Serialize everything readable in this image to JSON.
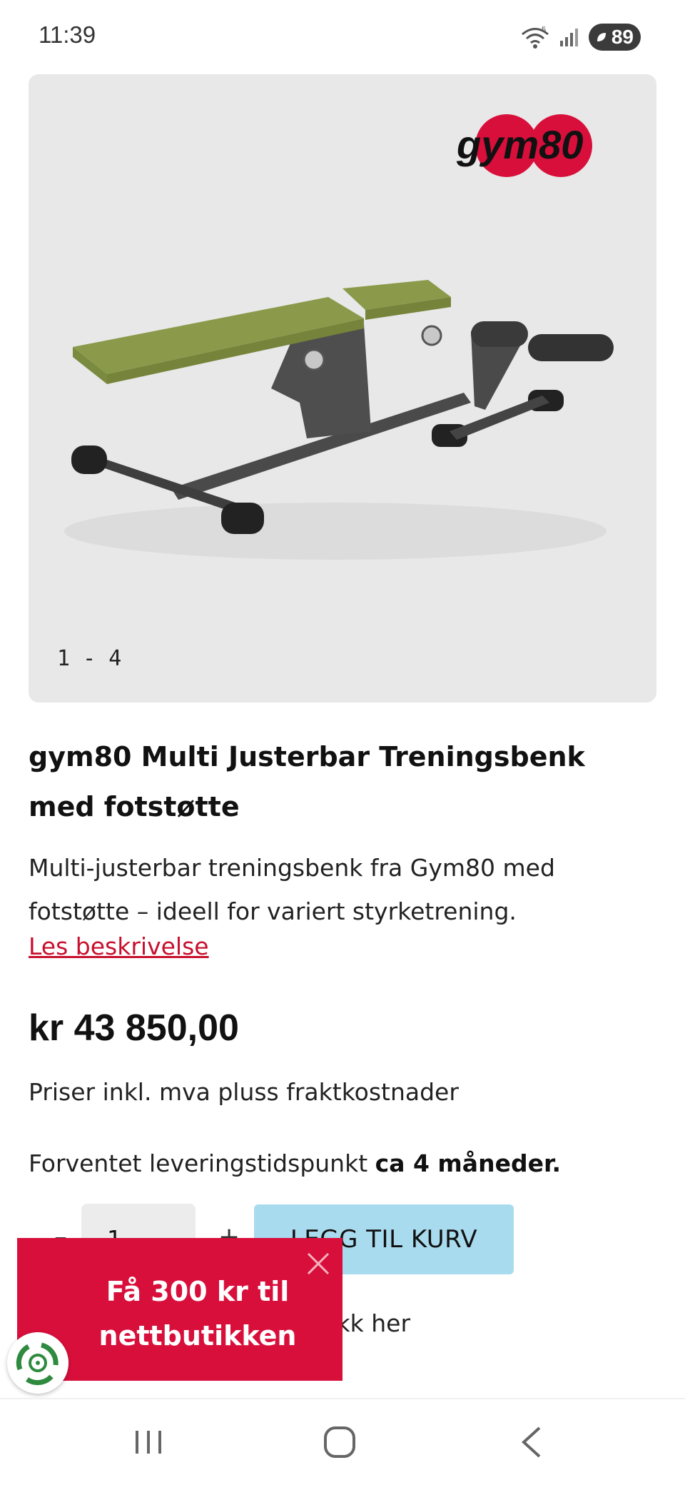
{
  "status_bar": {
    "time": "11:39",
    "battery": "89",
    "wifi_label": "5"
  },
  "gallery": {
    "brand_logo_text": "gym80",
    "counter": "1 - 4"
  },
  "product": {
    "title": "gym80 Multi Justerbar Treningsbenk med fotstøtte",
    "description": "Multi-justerbar treningsbenk fra Gym80 med fotstøtte – ideell for variert styrketrening.",
    "read_more": "Les beskrivelse",
    "price": "kr 43 850,00",
    "vat_note": "Priser inkl. mva pluss fraktkostnader",
    "delivery_prefix": "Forventet leveringstidspunkt",
    "delivery_value": "ca 4 måneder."
  },
  "cart": {
    "quantity": "1",
    "minus": "–",
    "plus": "+",
    "add_to_cart": "LEGG TIL KURV",
    "customer_link": "kunde - klikk her"
  },
  "promo": {
    "text": "Få 300 kr til nettbutikken"
  },
  "colors": {
    "accent_red": "#d80f3b",
    "link_red": "#c8102e",
    "cart_blue": "#a9dbef",
    "bench_green": "#8a9a4a"
  }
}
